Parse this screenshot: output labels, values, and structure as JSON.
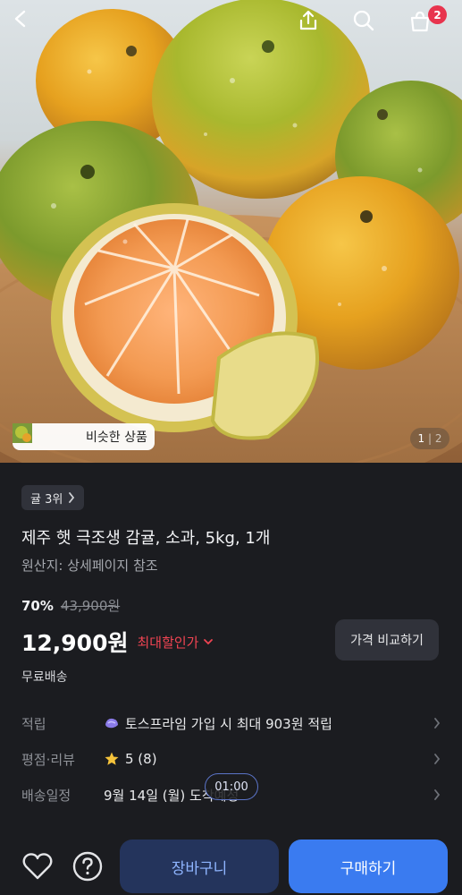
{
  "header": {
    "cart_badge_count": "2",
    "icons": [
      "back-icon",
      "share-icon",
      "search-icon",
      "shopping-bag-icon"
    ]
  },
  "gallery": {
    "similar_label": "비슷한 상품",
    "page_current": "1",
    "page_total": "2"
  },
  "product": {
    "rank_label": "귤 3위",
    "title": "제주 햇 극조생 감귤, 소과, 5kg, 1개",
    "origin": "원산지: 상세페이지 참조",
    "discount_rate": "70%",
    "original_price": "43,900원",
    "price": "12,900원",
    "best_price_label": "최대할인가",
    "compare_button": "가격 비교하기",
    "shipping": "무료배송"
  },
  "info": {
    "points_key": "적립",
    "points_value": "토스프라임 가입 시 최대 903원 적립",
    "rating_key": "평점·리뷰",
    "rating_value": "5 (8)",
    "delivery_key": "배송일정",
    "delivery_value": "9월 14일 (월) 도착예정"
  },
  "timer": "01:00",
  "bottom": {
    "cart_button": "장바구니",
    "buy_button": "구매하기"
  },
  "colors": {
    "background": "#1b1c20",
    "accent_blue": "#3a7bf0",
    "discount_red": "#f04452",
    "badge_red": "#e8344e"
  }
}
